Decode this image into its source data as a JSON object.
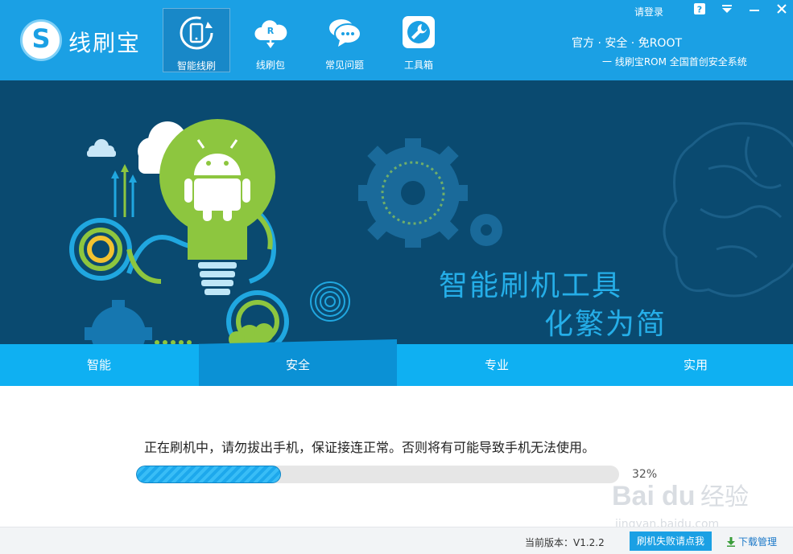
{
  "app": {
    "title": "线刷宝",
    "logo_letter": "S"
  },
  "header": {
    "login": "请登录",
    "slogan_line1": "官方 · 安全 · 免ROOT",
    "slogan_line2": "一 线刷宝ROM 全国首创安全系统",
    "nav": [
      {
        "label": "智能线刷",
        "icon": "phone-refresh-icon",
        "active": true
      },
      {
        "label": "线刷包",
        "icon": "cloud-download-icon",
        "active": false
      },
      {
        "label": "常见问题",
        "icon": "chat-bubble-icon",
        "active": false
      },
      {
        "label": "工具箱",
        "icon": "wrench-icon",
        "active": false
      }
    ],
    "window_controls": [
      "help-icon",
      "menu-icon",
      "minimize-icon",
      "close-icon"
    ],
    "help_glyph": "?"
  },
  "banner": {
    "line1": "智能刷机工具",
    "line2": "化繁为简"
  },
  "tabs": [
    {
      "label": "智能",
      "active": false
    },
    {
      "label": "安全",
      "active": true
    },
    {
      "label": "专业",
      "active": false
    },
    {
      "label": "实用",
      "active": false
    }
  ],
  "flash": {
    "message": "正在刷机中，请勿拔出手机，保证接连正常。否则将有可能导致手机无法使用。",
    "progress": 0.3,
    "percent_text": "32%"
  },
  "footer": {
    "version": "当前版本：V1.2.2",
    "fail_button": "刷机失败请点我",
    "download": "下载管理"
  },
  "watermark": {
    "brand": "Bai",
    "brand2": "du",
    "cn": "经验",
    "url": "jingyan.baidu.com"
  },
  "colors": {
    "header": "#1ba0e4",
    "banner": "#0a4a70",
    "tabs": "#0fb0f2",
    "tab_active": "#0b91d5",
    "android_green": "#8dc63f"
  }
}
